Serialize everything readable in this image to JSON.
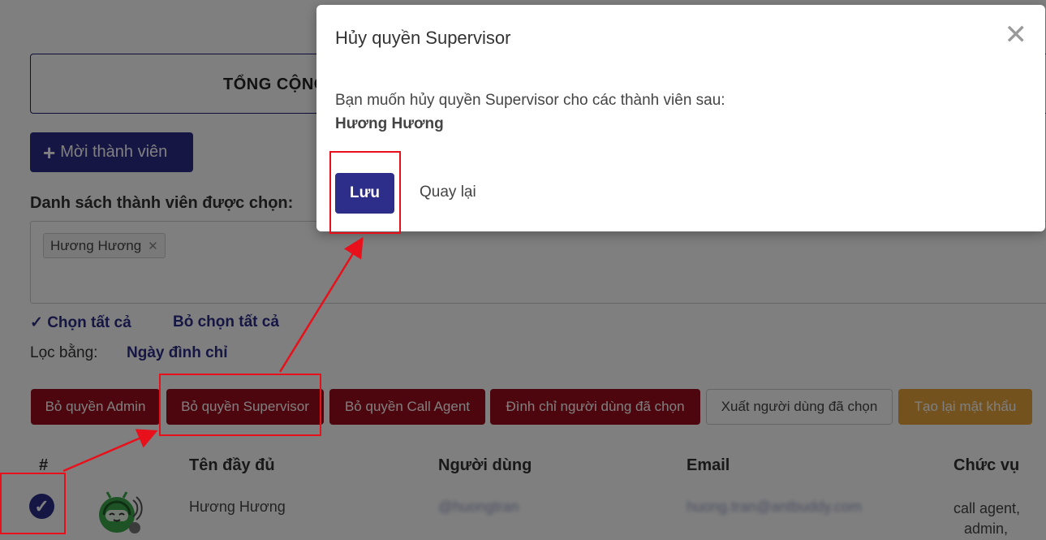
{
  "background": {
    "summary_title": "TỔNG CỘNG",
    "invite_button": "Mời thành viên",
    "selected_label": "Danh sách thành viên được chọn:",
    "selected_chip": "Hương Hương",
    "chip_remove": "✕",
    "select_all": "✓ Chọn tất cả",
    "deselect_all": "Bỏ chọn tất cả",
    "filter_label": "Lọc bằng:",
    "filter_value": "Ngày đình chỉ",
    "actions": [
      "Bỏ quyền Admin",
      "Bỏ quyền Supervisor",
      "Bỏ quyền Call Agent",
      "Đình chỉ người dùng đã chọn",
      "Xuất người dùng đã chọn",
      "Tạo lại mật khẩu"
    ],
    "table": {
      "headers": [
        "#",
        "Tên đầy đủ",
        "Người dùng",
        "Email",
        "Chức vụ"
      ],
      "row": {
        "check": "✓",
        "full_name": "Hương Hương",
        "username": "@huongtran",
        "email": "huong.tran@antbuddy.com",
        "roles": [
          "call agent,",
          "admin,"
        ]
      }
    }
  },
  "modal": {
    "title": "Hủy quyền Supervisor",
    "close": "✕",
    "message": "Bạn muốn hủy quyền Supervisor cho các thành viên sau:",
    "member": "Hương Hương",
    "save": "Lưu",
    "back": "Quay lại"
  },
  "colors": {
    "primary": "#2d2d8a",
    "danger": "#9b0d1c",
    "warning": "#e7a43c",
    "annotation": "#e8101a"
  }
}
